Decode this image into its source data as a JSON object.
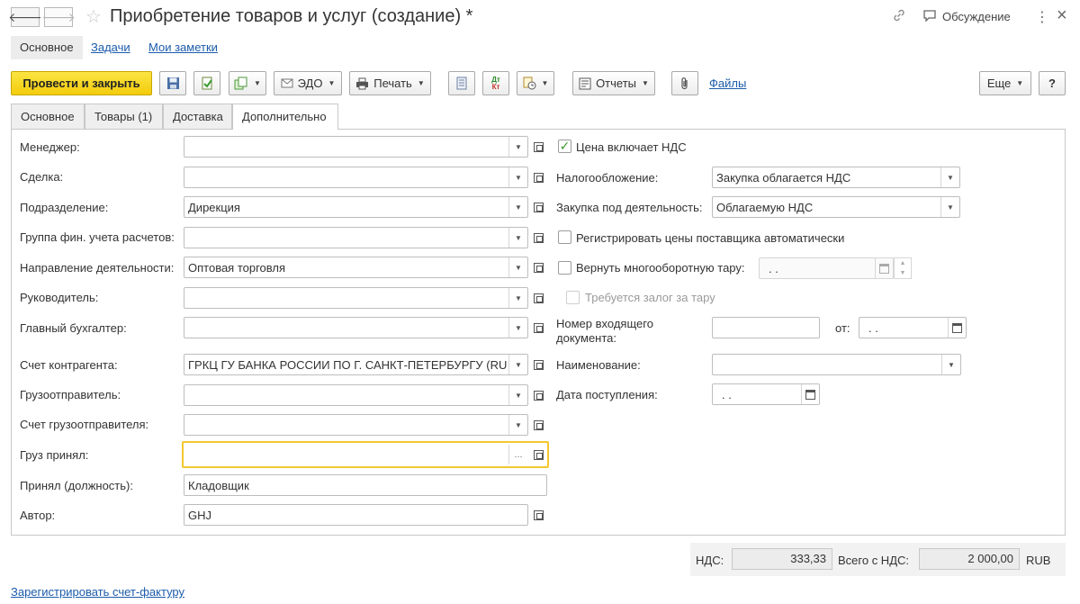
{
  "title": "Приобретение товаров и услуг (создание) *",
  "title_right": {
    "discussion": "Обсуждение",
    "more": "⋮",
    "close": "×"
  },
  "nav_tabs": [
    "Основное",
    "Задачи",
    "Мои заметки"
  ],
  "toolbar": {
    "post_close": "Провести и закрыть",
    "edo": "ЭДО",
    "print": "Печать",
    "reports": "Отчеты",
    "files": "Файлы",
    "more": "Еще",
    "help": "?",
    "dt_kt_top": "Дт",
    "dt_kt_bottom": "Кт"
  },
  "form_tabs": [
    "Основное",
    "Товары (1)",
    "Доставка",
    "Дополнительно"
  ],
  "left_fields": [
    {
      "label": "Менеджер:",
      "value": ""
    },
    {
      "label": "Сделка:",
      "value": ""
    },
    {
      "label": "Подразделение:",
      "value": "Дирекция"
    },
    {
      "label": "Группа фин. учета расчетов:",
      "value": ""
    },
    {
      "label": "Направление деятельности:",
      "value": "Оптовая торговля"
    },
    {
      "label": "Руководитель:",
      "value": ""
    },
    {
      "label": "Главный бухгалтер:",
      "value": ""
    },
    {
      "label": "Счет контрагента:",
      "value": "ГРКЦ ГУ БАНКА РОССИИ ПО Г. САНКТ-ПЕТЕРБУРГУ (RU"
    },
    {
      "label": "Грузоотправитель:",
      "value": ""
    },
    {
      "label": "Счет грузоотправителя:",
      "value": ""
    },
    {
      "label": "Груз принял:",
      "value": ""
    },
    {
      "label": "Принял (должность):",
      "value": "Кладовщик"
    },
    {
      "label": "Автор:",
      "value": "GHJ"
    }
  ],
  "right": {
    "price_includes_vat": "Цена включает НДС",
    "taxation_label": "Налогообложение:",
    "taxation_value": "Закупка облагается НДС",
    "activity_label": "Закупка под деятельность:",
    "activity_value": "Облагаемую НДС",
    "register_prices": "Регистрировать цены поставщика автоматически",
    "return_tare": "Вернуть многооборотную тару:",
    "return_tare_date": ". .",
    "deposit_required": "Требуется залог за тару",
    "incoming_doc_label": "Номер входящего документа:",
    "from_label": "от:",
    "from_date": ". .",
    "name_label": "Наименование:",
    "receipt_date_label": "Дата поступления:",
    "receipt_date": ". ."
  },
  "totals": {
    "vat_label": "НДС:",
    "vat_value": "333,33",
    "total_label": "Всего с НДС:",
    "total_value": "2 000,00",
    "currency": "RUB"
  },
  "footer_link": "Зарегистрировать счет-фактуру"
}
